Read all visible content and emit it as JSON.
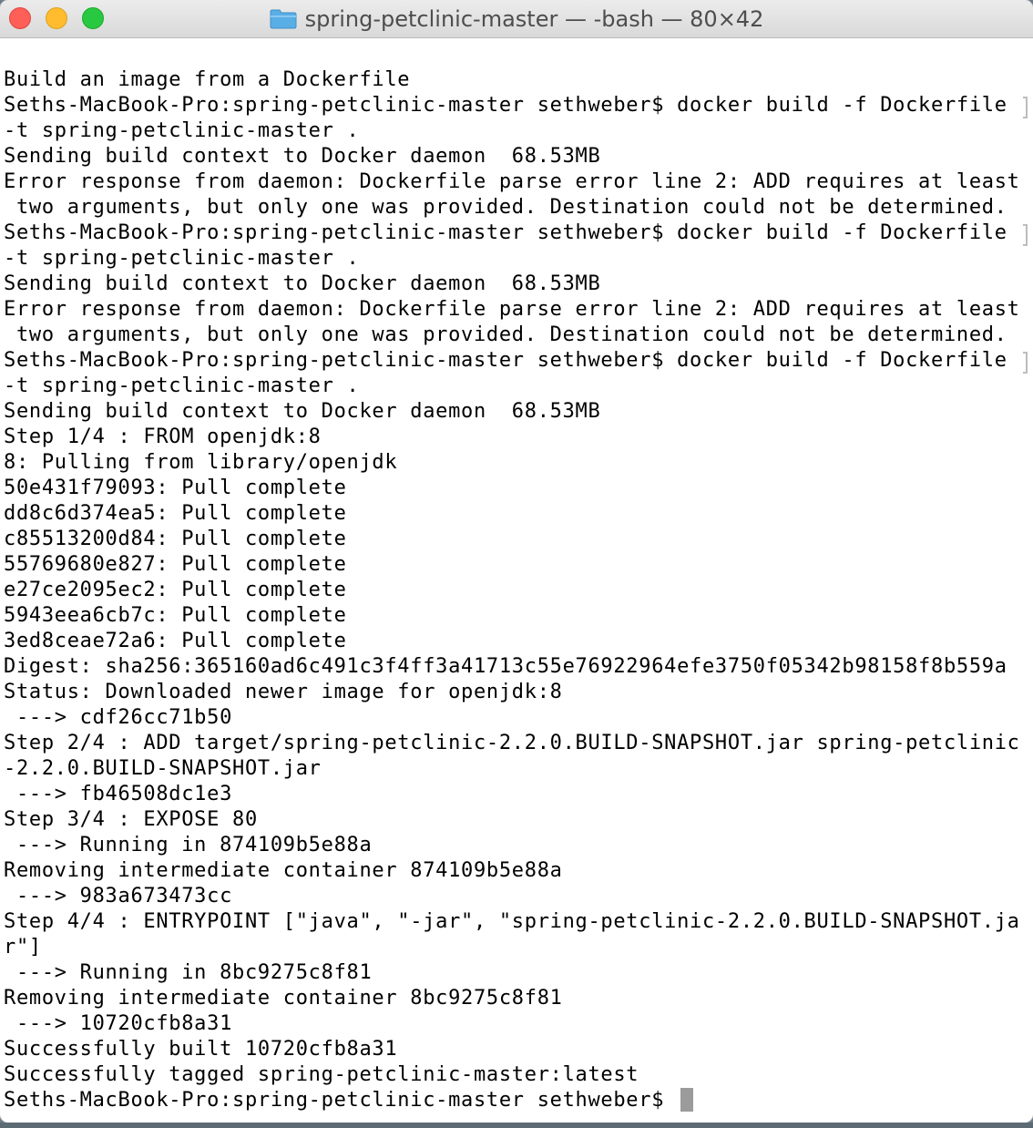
{
  "window": {
    "title": "spring-petclinic-master — -bash — 80×42"
  },
  "terminal": {
    "lines": [
      "",
      "Build an image from a Dockerfile",
      "Seths-MacBook-Pro:spring-petclinic-master sethweber$ docker build -f Dockerfile ",
      "-t spring-petclinic-master .",
      "Sending build context to Docker daemon  68.53MB",
      "Error response from daemon: Dockerfile parse error line 2: ADD requires at least",
      " two arguments, but only one was provided. Destination could not be determined.",
      "Seths-MacBook-Pro:spring-petclinic-master sethweber$ docker build -f Dockerfile ",
      "-t spring-petclinic-master .",
      "Sending build context to Docker daemon  68.53MB",
      "Error response from daemon: Dockerfile parse error line 2: ADD requires at least",
      " two arguments, but only one was provided. Destination could not be determined.",
      "Seths-MacBook-Pro:spring-petclinic-master sethweber$ docker build -f Dockerfile ",
      "-t spring-petclinic-master .",
      "Sending build context to Docker daemon  68.53MB",
      "Step 1/4 : FROM openjdk:8",
      "8: Pulling from library/openjdk",
      "50e431f79093: Pull complete",
      "dd8c6d374ea5: Pull complete",
      "c85513200d84: Pull complete",
      "55769680e827: Pull complete",
      "e27ce2095ec2: Pull complete",
      "5943eea6cb7c: Pull complete",
      "3ed8ceae72a6: Pull complete",
      "Digest: sha256:365160ad6c491c3f4ff3a41713c55e76922964efe3750f05342b98158f8b559a",
      "Status: Downloaded newer image for openjdk:8",
      " ---> cdf26cc71b50",
      "Step 2/4 : ADD target/spring-petclinic-2.2.0.BUILD-SNAPSHOT.jar spring-petclinic",
      "-2.2.0.BUILD-SNAPSHOT.jar",
      " ---> fb46508dc1e3",
      "Step 3/4 : EXPOSE 80",
      " ---> Running in 874109b5e88a",
      "Removing intermediate container 874109b5e88a",
      " ---> 983a673473cc",
      "Step 4/4 : ENTRYPOINT [\"java\", \"-jar\", \"spring-petclinic-2.2.0.BUILD-SNAPSHOT.ja",
      "r\"]",
      " ---> Running in 8bc9275c8f81",
      "Removing intermediate container 8bc9275c8f81",
      " ---> 10720cfb8a31",
      "Successfully built 10720cfb8a31",
      "Successfully tagged spring-petclinic-master:latest"
    ],
    "prompt": "Seths-MacBook-Pro:spring-petclinic-master sethweber$ "
  },
  "icons": {
    "title_icon": "folder-icon",
    "close": "close-icon",
    "minimize": "minimize-icon",
    "maximize": "maximize-icon"
  },
  "colors": {
    "close": "#fe5f57",
    "minimize": "#febc2e",
    "maximize": "#28c840",
    "folder": "#5aaee6",
    "text": "#000000",
    "background": "#ffffff"
  }
}
